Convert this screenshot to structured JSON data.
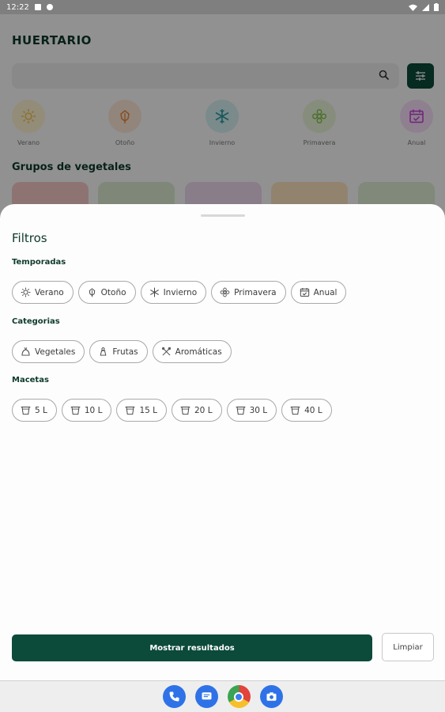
{
  "status_bar": {
    "time": "12:22"
  },
  "app": {
    "title": "HUERTARIO",
    "seasons": [
      {
        "label": "Verano",
        "color": "#f3c14a",
        "bg": "#fbf1d0"
      },
      {
        "label": "Otoño",
        "color": "#e8853b",
        "bg": "#fbe6d5"
      },
      {
        "label": "Invierno",
        "color": "#2a9aa0",
        "bg": "#d4eeee"
      },
      {
        "label": "Primavera",
        "color": "#7cbf43",
        "bg": "#e7f3d8"
      },
      {
        "label": "Anual",
        "color": "#c23bd4",
        "bg": "#f4dcf6"
      }
    ],
    "groups_title": "Grupos de vegetales"
  },
  "sheet": {
    "title": "Filtros",
    "seasons_label": "Temporadas",
    "season_chips": [
      {
        "label": "Verano",
        "icon": "sun-icon"
      },
      {
        "label": "Otoño",
        "icon": "leaf-icon"
      },
      {
        "label": "Invierno",
        "icon": "snowflake-icon"
      },
      {
        "label": "Primavera",
        "icon": "flower-icon"
      },
      {
        "label": "Anual",
        "icon": "calendar-icon"
      }
    ],
    "categories_label": "Categorias",
    "category_chips": [
      {
        "label": "Vegetales",
        "icon": "vegetable-icon"
      },
      {
        "label": "Frutas",
        "icon": "fruit-icon"
      },
      {
        "label": "Aromáticas",
        "icon": "herb-icon"
      }
    ],
    "pots_label": "Macetas",
    "pot_chips": [
      {
        "label": "5 L",
        "icon": "pot-icon"
      },
      {
        "label": "10 L",
        "icon": "pot-icon"
      },
      {
        "label": "15 L",
        "icon": "pot-icon"
      },
      {
        "label": "20 L",
        "icon": "pot-icon"
      },
      {
        "label": "30 L",
        "icon": "pot-icon"
      },
      {
        "label": "40 L",
        "icon": "pot-icon"
      }
    ],
    "show_results_label": "Mostrar resultados",
    "clear_label": "Limpiar"
  },
  "colors": {
    "primary": "#0c4a3a",
    "scrim": "rgba(0,0,0,0.42)"
  }
}
